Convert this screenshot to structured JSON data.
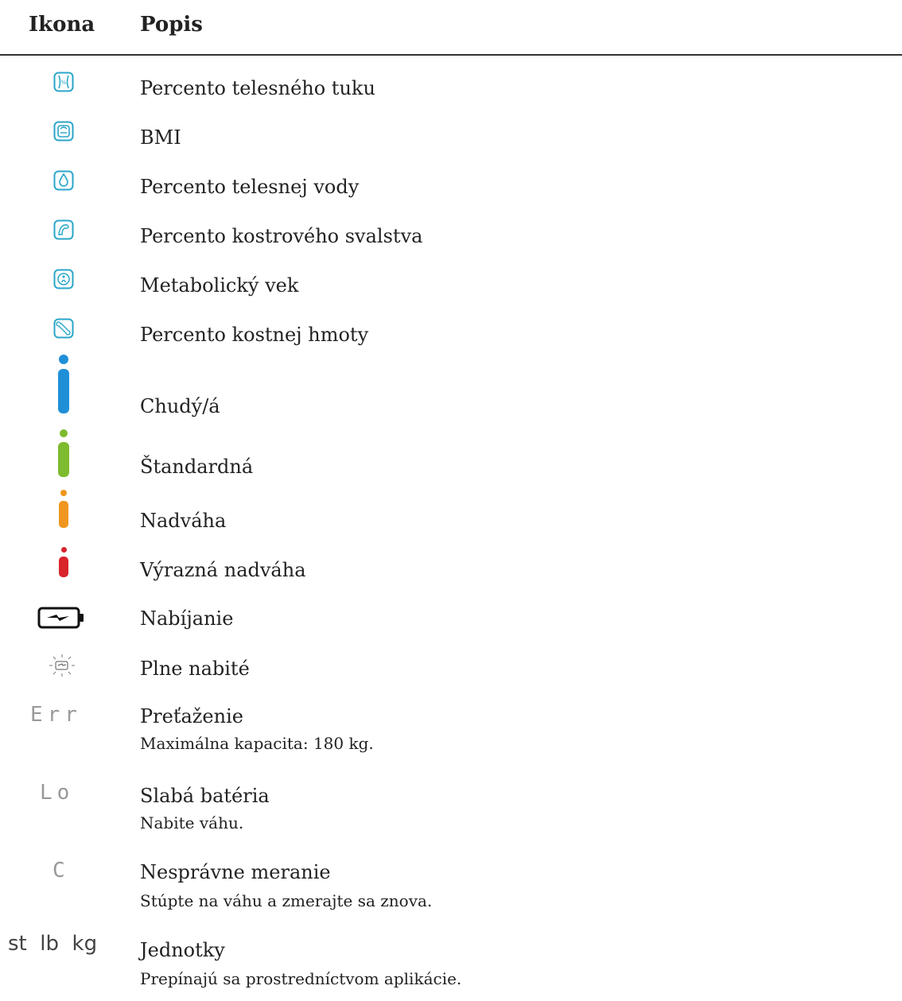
{
  "header": {
    "icon_col": "Ikona",
    "desc_col": "Popis"
  },
  "colors": {
    "blue": "#1f8fd8",
    "green": "#7dbb2f",
    "orange": "#f0961e",
    "red": "#d8242a",
    "icon_teal": "#2aa6c9"
  },
  "rows": [
    {
      "icon": "body-fat-icon",
      "label": "Percento telesného tuku"
    },
    {
      "icon": "scale-bmi-icon",
      "label": "BMI"
    },
    {
      "icon": "water-drop-icon",
      "label": "Percento telesnej vody"
    },
    {
      "icon": "muscle-icon",
      "label": "Percento kostrového svalstva"
    },
    {
      "icon": "metabolic-age-icon",
      "label": "Metabolický vek"
    },
    {
      "icon": "bone-icon",
      "label": "Percento kostnej hmoty"
    },
    {
      "icon": "indicator-blue-icon",
      "label": "Chudý/á"
    },
    {
      "icon": "indicator-green-icon",
      "label": "Štandardná"
    },
    {
      "icon": "indicator-orange-icon",
      "label": "Nadváha"
    },
    {
      "icon": "indicator-red-icon",
      "label": "Výrazná nadváha"
    },
    {
      "icon": "battery-charging-icon",
      "label": "Nabíjanie"
    },
    {
      "icon": "battery-full-icon",
      "label": "Plne nabité"
    },
    {
      "icon": "err-display-icon",
      "display": "Err",
      "label": "Preťaženie",
      "sub": "Maximálna kapacita: 180 kg."
    },
    {
      "icon": "lo-display-icon",
      "display": "Lo",
      "label": "Slabá batéria",
      "sub": "Nabite váhu."
    },
    {
      "icon": "c-display-icon",
      "display": "C",
      "label": "Nesprávne meranie",
      "sub": "Stúpte na váhu a zmerajte sa znova."
    },
    {
      "icon": "units-display-icon",
      "display": "st  lb  kg",
      "label": "Jednotky",
      "sub": "Prepínajú sa prostredníctvom aplikácie."
    }
  ]
}
